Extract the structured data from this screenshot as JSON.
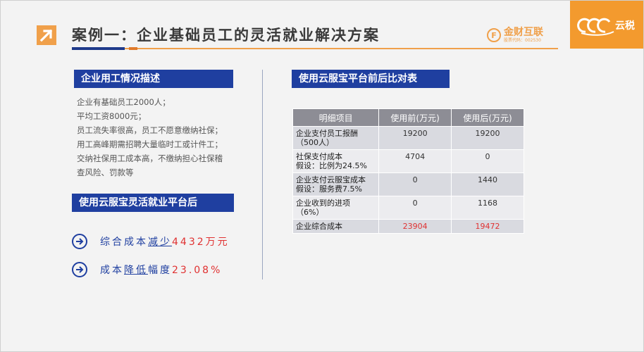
{
  "header": {
    "title": "案例一：企业基础员工的灵活就业解决方案",
    "brand_name": "金财互联",
    "brand_code": "股票代码：002530",
    "logo_text": "云税"
  },
  "left": {
    "section1_title": "企业用工情况描述",
    "desc_lines": [
      "企业有基础员工2000人；",
      "平均工资8000元；",
      "员工流失率很高，员工不愿意缴纳社保；",
      "用工高峰期需招聘大量临时工或计件工；",
      "交纳社保用工成本高，不缴纳担心社保稽",
      "查风险、罚款等"
    ],
    "section2_title": "使用云服宝灵活就业平台后",
    "benefit1_prefix": "综合成本",
    "benefit1_under": "减少",
    "benefit1_value": "4432万元",
    "benefit2_prefix": "成本",
    "benefit2_under": "降低",
    "benefit2_mid": "幅度",
    "benefit2_value": "23.08%"
  },
  "right": {
    "section_title": "使用云服宝平台前后比对表",
    "table": {
      "headers": [
        "明细项目",
        "使用前(万元)",
        "使用后(万元)"
      ],
      "rows": [
        {
          "item1": "企业支付员工报酬",
          "item2": "（500人）",
          "before": "19200",
          "after": "19200"
        },
        {
          "item1": "社保支付成本",
          "item2": "假设：比例为24.5%",
          "before": "4704",
          "after": "0"
        },
        {
          "item1": "企业支付云服宝成本",
          "item2": "假设：服务费7.5%",
          "before": "0",
          "after": "1440"
        },
        {
          "item1": "企业收到的进项",
          "item2": "（6%）",
          "before": "0",
          "after": "1168"
        },
        {
          "item1": "企业综合成本",
          "item2": "",
          "before": "23904",
          "after": "19472"
        }
      ]
    }
  },
  "colors": {
    "accent_orange": "#f0a04a",
    "section_blue": "#1f3fa0",
    "highlight_red": "#e03131",
    "table_header": "#8d8d95"
  }
}
